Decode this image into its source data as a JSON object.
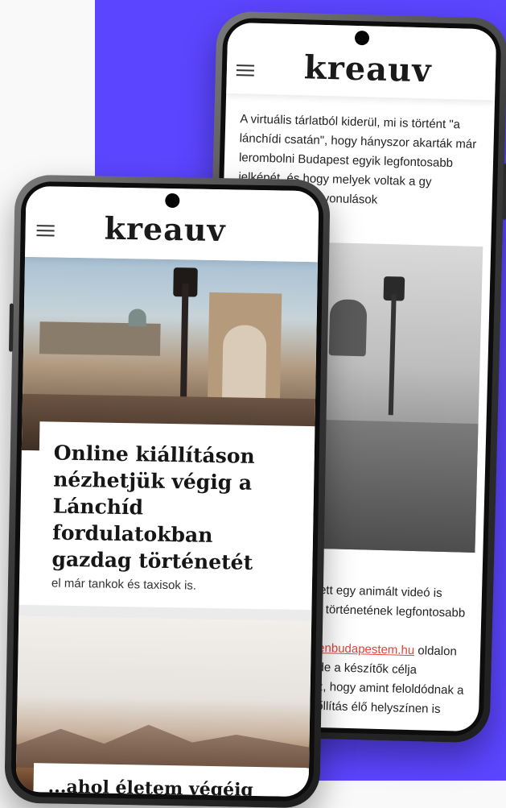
{
  "brand": {
    "logo_text": "kreauv",
    "accent_color": "#5b45ff",
    "link_color": "#e0433a"
  },
  "back_phone": {
    "intro": "A virtuális tárlatból kiderül, mi is történt \"a lánchídi csatán\", hogy hányszor akarták már lerombolni Budapest egyik legfontosabb jelképét, és hogy melyek voltak a",
    "intro_tail": "gy legfontosabb felvonulások",
    "tail_line1": "ett egy animált videó is",
    "tail_line2": ", történetének legfontosabb",
    "tail_link": "enbudapestem.hu",
    "tail_line3_rest": " oldalon",
    "tail_line4": "de a készítők célja",
    "tail_line5": "z, hogy amint feloldódnak a",
    "tail_line6": "őllítás élő helyszínen is"
  },
  "front_phone": {
    "headline": "Online kiállításon nézhetjük végig a Lánchíd fordulatokban gazdag történetét",
    "lede": "Többször is le akarták rombolni, torlaszolták el már tankok és taxisok is.",
    "second_headline": "...ahol életem végéig"
  }
}
